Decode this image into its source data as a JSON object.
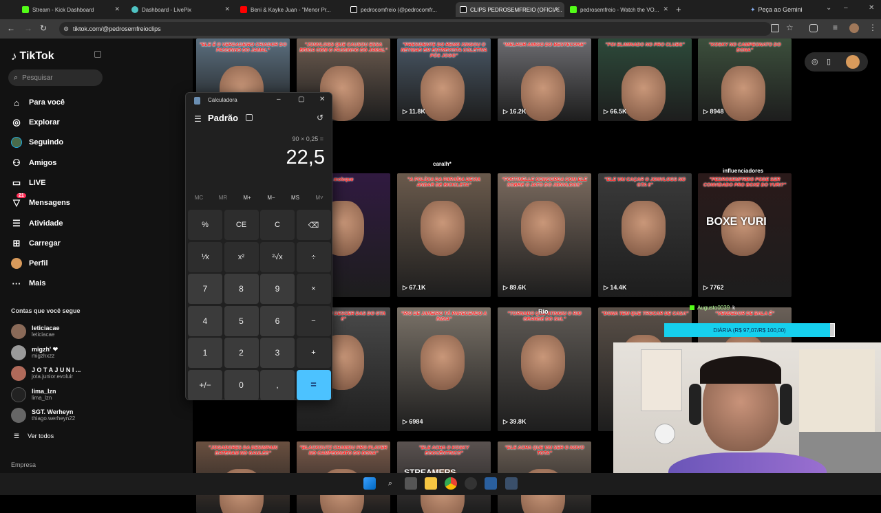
{
  "browser": {
    "tabs": [
      {
        "title": "Stream - Kick Dashboard",
        "color": "#53fc18"
      },
      {
        "title": "Dashboard - LivePix",
        "color": "#4fc3c3"
      },
      {
        "title": "Beni & Kayke Juan - \"Menor Pr...",
        "color": "#ff0000"
      },
      {
        "title": "pedrocomfreio (@pedrocomfr...",
        "color": "#111111"
      },
      {
        "title": "CLIPS PEDROSEMFREIO (OFICIA...",
        "color": "#111111"
      },
      {
        "title": "pedrosemfreio - Watch the VO...",
        "color": "#53fc18"
      }
    ],
    "new_tab": "+",
    "gemini_label": "Peça ao Gemini",
    "url": "tiktok.com/@pedrosemfreioclips"
  },
  "tiktok": {
    "brand": "TikTok",
    "search_placeholder": "Pesquisar",
    "nav": [
      {
        "label": "Para você",
        "icon": "home-icon"
      },
      {
        "label": "Explorar",
        "icon": "compass-icon"
      },
      {
        "label": "Seguindo",
        "icon": "following-avatar-icon"
      },
      {
        "label": "Amigos",
        "icon": "friends-icon"
      },
      {
        "label": "LIVE",
        "icon": "live-icon"
      },
      {
        "label": "Mensagens",
        "icon": "messages-icon",
        "badge": "21"
      },
      {
        "label": "Atividade",
        "icon": "activity-icon"
      },
      {
        "label": "Carregar",
        "icon": "upload-icon"
      },
      {
        "label": "Perfil",
        "icon": "profile-avatar-icon"
      },
      {
        "label": "Mais",
        "icon": "more-icon"
      }
    ],
    "following_title": "Contas que você segue",
    "accounts": [
      {
        "name": "leticiacae",
        "user": "leticiacae"
      },
      {
        "name": "migzh' ❤",
        "user": "migzhxzz"
      },
      {
        "name": "J O T A  J U N I ...",
        "user": "jota.junior.evoluir"
      },
      {
        "name": "lima_lzn",
        "user": "lima_lzn"
      },
      {
        "name": "SGT. Werheyn",
        "user": "thiago.werheyn22"
      }
    ],
    "see_all": "Ver todos",
    "footer": "Empresa"
  },
  "videos": [
    {
      "caption": "\"ELE É O VERDADEIRO CRIADOR DO PASSINHO DO JAMAL\"",
      "views": ""
    },
    {
      "caption": "\"JONVLOGS QUE CAUSOU ESSA BRIGA COM O PASSINHO DO JAMAL\"",
      "views": ""
    },
    {
      "caption": "\"PRESIDENTE DO REMO XINGOU O NEYMAR EM ENTREVISTA COLETIVA PÓS JOGO\"",
      "views": "11.8K"
    },
    {
      "caption": "\"MELHOR AMIGO DO BESTECONE\"",
      "views": "16.2K"
    },
    {
      "caption": "\"FOI ELIMINADO NO PRO CLUBS\"",
      "views": "66.5K"
    },
    {
      "caption": "\"KOSKY NO CAMPEONATO DO DONA\"",
      "views": "8948"
    },
    {
      "caption": "moleque",
      "views": ""
    },
    {
      "caption": "\"A POLÍCIA DA PARAÍBA DEVIA ANDAR DE BICICLETA\"",
      "views": "67.1K"
    },
    {
      "caption": "\"FORTINELLE CONCORDA COM ELE SOBRE O JATO DO JONVLOGS\"",
      "views": "89.6K"
    },
    {
      "caption": "\"ELE VAI CAÇAR O JONVLOGS NO GTA 6\"",
      "views": "14.4K"
    },
    {
      "caption": "\"PEDROSEMFREIO PODE SER CONVIDADO PRO BOXE DO YURI?\"",
      "views": "7762"
    },
    {
      "caption": "\"CONSEGUIU DESCER DAS DO GTA 6\"",
      "views": ""
    },
    {
      "caption": "\"RIO DE JANEIRO TÁ PARECENDO A ÍNDIA\"",
      "views": "6984"
    },
    {
      "caption": "\"TORNADO QUE ATINGIU O RIO GRANDE DO SUL\"",
      "views": "39.8K"
    },
    {
      "caption": "\"DONA TEM QUE TROCAR DE CASA\"",
      "views": ""
    },
    {
      "caption": "\"VENDEDOR DE BALA É\"",
      "views": ""
    },
    {
      "caption": "\"JOGADORES DA DESIMPAIN BATERAM NO GAULES\"",
      "views": ""
    },
    {
      "caption": "\"BLACKOUTZ CHAMOU PRO PLAYER NO CAMPEONATO DO DONA\"",
      "views": ""
    },
    {
      "caption": "\"ELE ACHA O KOSKY EGOCÊNTRICO\"",
      "views": ""
    },
    {
      "caption": "\"ELE ACHA QUE VAI SER O NOVO TOTA\"",
      "views": ""
    }
  ],
  "overlay_text": {
    "video3_label": "caralh*",
    "video5_label": "influenciadores",
    "video4_label": "Rio",
    "boxe": "BOXE YURI",
    "streamers": "STREAMERS"
  },
  "calculator": {
    "title": "Calculadora",
    "mode": "Padrão",
    "expression": "90 × 0,25 =",
    "result": "22,5",
    "memory": [
      "MC",
      "MR",
      "M+",
      "M−",
      "MS",
      "M˅"
    ],
    "keys": [
      [
        "%",
        "CE",
        "C",
        "⌫"
      ],
      [
        "⅟x",
        "x²",
        "²√x",
        "÷"
      ],
      [
        "7",
        "8",
        "9",
        "×"
      ],
      [
        "4",
        "5",
        "6",
        "−"
      ],
      [
        "1",
        "2",
        "3",
        "+"
      ],
      [
        "+/−",
        "0",
        ",",
        "="
      ]
    ]
  },
  "stream": {
    "donor": "Augusto0039",
    "donor_suffix": "k",
    "goal_text": "DIÁRIA (R$ 97,07/R$ 100,00)",
    "goal_progress": 0.9707
  },
  "colors": {
    "tiktok_red": "#fe2c55",
    "calc_accent": "#4cc2ff",
    "goal_fill": "#16d0ee"
  }
}
